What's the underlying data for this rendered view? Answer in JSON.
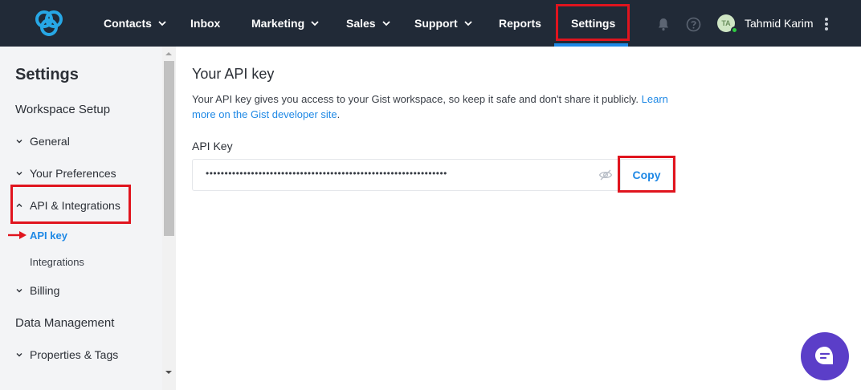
{
  "nav": {
    "items": [
      {
        "label": "Contacts",
        "dropdown": true
      },
      {
        "label": "Inbox",
        "dropdown": false
      },
      {
        "label": "Marketing",
        "dropdown": true
      },
      {
        "label": "Sales",
        "dropdown": true
      },
      {
        "label": "Support",
        "dropdown": true
      },
      {
        "label": "Reports",
        "dropdown": false
      },
      {
        "label": "Settings",
        "dropdown": false,
        "active": true
      }
    ],
    "user": {
      "initials": "TA",
      "name": "Tahmid Karim",
      "status": "online"
    }
  },
  "sidebar": {
    "title": "Settings",
    "sections": [
      {
        "label": "Workspace Setup"
      },
      {
        "label": "Data Management"
      }
    ],
    "items": [
      {
        "label": "General",
        "expanded": false
      },
      {
        "label": "Your Preferences",
        "expanded": false
      },
      {
        "label": "API & Integrations",
        "expanded": true
      },
      {
        "label": "Billing",
        "expanded": false
      },
      {
        "label": "Properties & Tags",
        "expanded": false
      }
    ],
    "subitems": [
      {
        "label": "API key",
        "active": true
      },
      {
        "label": "Integrations",
        "active": false
      }
    ]
  },
  "main": {
    "title": "Your API key",
    "description": "Your API key gives you access to your Gist workspace, so keep it safe and don't share it publicly.",
    "link_text_1": "Learn",
    "link_text_2": "more on the Gist developer site",
    "link_suffix": ".",
    "field_label": "API Key",
    "key_masked": "••••••••••••••••••••••••••••••••••••••••••••••••••••••••••••••••",
    "copy_label": "Copy"
  },
  "colors": {
    "topbar": "#212a37",
    "accent": "#1e88e5",
    "highlight": "#e0141e",
    "chat": "#5b3ec8"
  }
}
